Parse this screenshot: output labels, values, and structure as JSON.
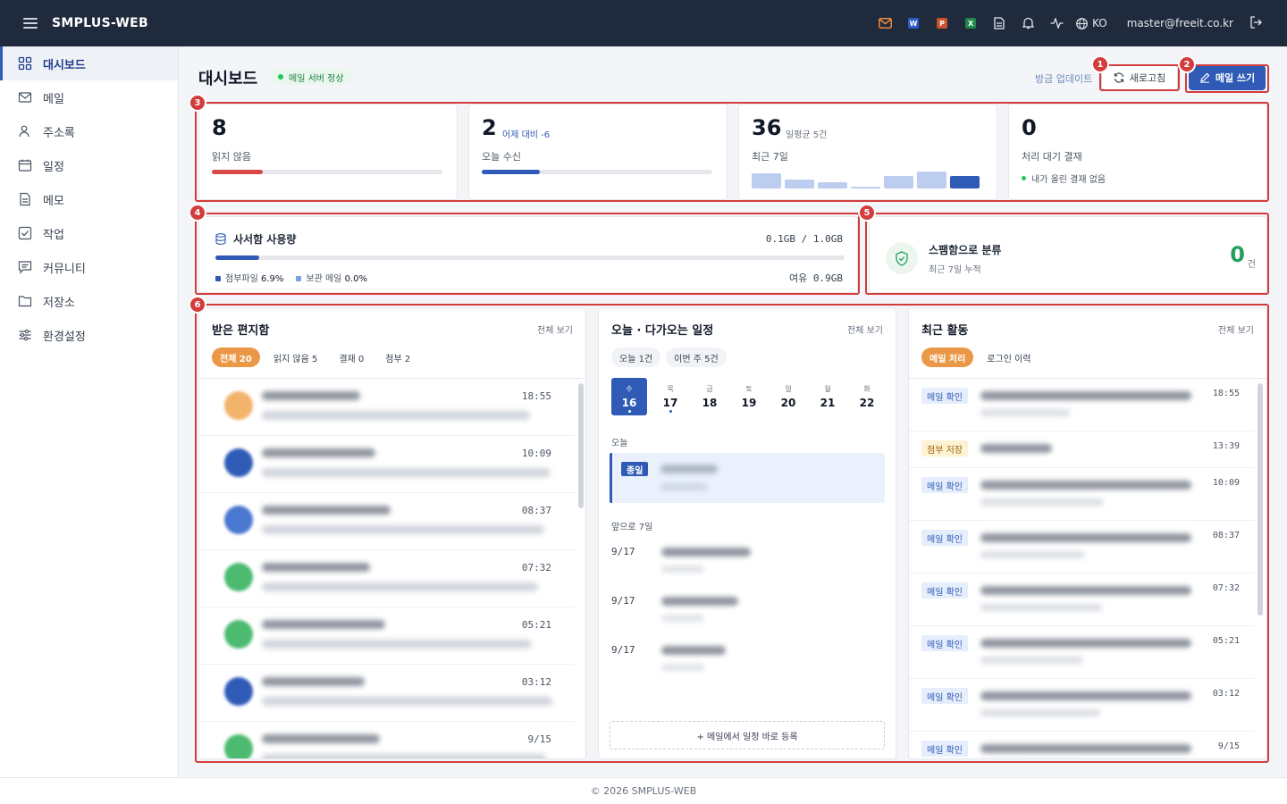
{
  "app": {
    "title": "SMPLUS-WEB"
  },
  "topbar": {
    "lang": "KO",
    "user": "master@freeit.co.kr",
    "doc_w": "W",
    "doc_p": "P",
    "doc_x": "X"
  },
  "sidebar": {
    "items": [
      {
        "label": "대시보드",
        "icon": "grid-icon",
        "active": true
      },
      {
        "label": "메일",
        "icon": "mail-icon"
      },
      {
        "label": "주소록",
        "icon": "contact-icon"
      },
      {
        "label": "일정",
        "icon": "calendar-icon"
      },
      {
        "label": "메모",
        "icon": "memo-icon"
      },
      {
        "label": "작업",
        "icon": "task-icon"
      },
      {
        "label": "커뮤니티",
        "icon": "community-icon"
      },
      {
        "label": "저장소",
        "icon": "folder-icon"
      },
      {
        "label": "환경설정",
        "icon": "settings-icon"
      }
    ]
  },
  "header": {
    "title": "대시보드",
    "server_status": "메일 서버 정상",
    "updated": "방금 업데이트",
    "refresh": "새로고침",
    "write": "메일 쓰기"
  },
  "annotations": [
    "1",
    "2",
    "3",
    "4",
    "5",
    "6"
  ],
  "kpis": [
    {
      "value": "8",
      "sub": "",
      "label": "읽지 않음",
      "progress": 0.22,
      "color": "#d94848"
    },
    {
      "value": "2",
      "sub": "어제 대비 -6",
      "label": "오늘 수신",
      "progress": 0.25,
      "color": "#2f5bb7"
    },
    {
      "value": "36",
      "sub": "일평균 5건",
      "label": "최근 7일",
      "bars": [
        0.7,
        0.4,
        0.3,
        0.05,
        0.6,
        0.8,
        0.6
      ]
    },
    {
      "value": "0",
      "sub": "",
      "label": "처리 대기 결재",
      "note": "내가 올린 결재 없음"
    }
  ],
  "storage": {
    "title": "사서함 사용량",
    "value": "0.1GB / 1.0GB",
    "attach_label": "첨부파일",
    "attach_pct": "6.9%",
    "archive_label": "보관 메일",
    "archive_pct": "0.0%",
    "free": "여유 0.9GB",
    "progress": 0.07
  },
  "spam": {
    "title": "스팸함으로 분류",
    "sub": "최근 7일 누적",
    "count": "0",
    "unit": "건"
  },
  "inbox": {
    "title": "받은 편지함",
    "link": "전체 보기",
    "tabs": [
      {
        "label": "전체 20"
      },
      {
        "label": "읽지 않음 5"
      },
      {
        "label": "결재 0"
      },
      {
        "label": "첨부 2"
      }
    ],
    "rows": [
      {
        "time": "18:55",
        "color": "#f2b36b"
      },
      {
        "time": "10:09",
        "color": "#2f5bb7"
      },
      {
        "time": "08:37",
        "color": "#4a78d0"
      },
      {
        "time": "07:32",
        "color": "#4cbb70"
      },
      {
        "time": "05:21",
        "color": "#4cbb70"
      },
      {
        "time": "03:12",
        "color": "#2f5bb7"
      },
      {
        "time": "9/15",
        "color": "#4cbb70"
      }
    ]
  },
  "calendar": {
    "title": "오늘 · 다가오는 일정",
    "link": "전체 보기",
    "pills": [
      {
        "label": "오늘 1건"
      },
      {
        "label": "이번 주 5건"
      }
    ],
    "days": [
      {
        "dow": "수",
        "num": "16"
      },
      {
        "dow": "목",
        "num": "17"
      },
      {
        "dow": "금",
        "num": "18"
      },
      {
        "dow": "토",
        "num": "19"
      },
      {
        "dow": "일",
        "num": "20"
      },
      {
        "dow": "월",
        "num": "21"
      },
      {
        "dow": "화",
        "num": "22"
      }
    ],
    "today_label": "오늘",
    "allday": "종일",
    "upcoming_label": "앞으로 7일",
    "upcoming": [
      {
        "date": "9/17"
      },
      {
        "date": "9/17"
      },
      {
        "date": "9/17"
      }
    ],
    "register": "+ 메일에서 일정 바로 등록"
  },
  "activity": {
    "title": "최근 활동",
    "link": "전체 보기",
    "tabs": [
      {
        "label": "메일 처리"
      },
      {
        "label": "로그인 이력"
      }
    ],
    "rows": [
      {
        "tag": "메일 확인",
        "kind": "blue",
        "time": "18:55"
      },
      {
        "tag": "첨부 저장",
        "kind": "yellow",
        "time": "13:39"
      },
      {
        "tag": "메일 확인",
        "kind": "blue",
        "time": "10:09"
      },
      {
        "tag": "메일 확인",
        "kind": "blue",
        "time": "08:37"
      },
      {
        "tag": "메일 확인",
        "kind": "blue",
        "time": "07:32"
      },
      {
        "tag": "메일 확인",
        "kind": "blue",
        "time": "05:21"
      },
      {
        "tag": "메일 확인",
        "kind": "blue",
        "time": "03:12"
      },
      {
        "tag": "메일 확인",
        "kind": "blue",
        "time": "9/15"
      }
    ]
  },
  "footer": {
    "text": "© 2026 SMPLUS-WEB"
  }
}
